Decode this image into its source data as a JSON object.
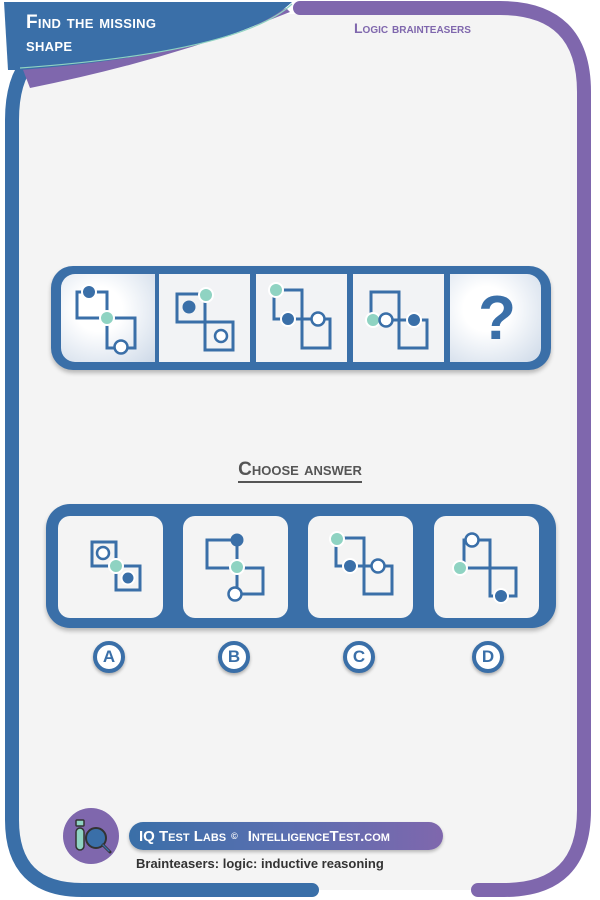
{
  "header": {
    "title_line1": "Find the missing",
    "title_line2": "shape",
    "category": "Logic brainteasers"
  },
  "colors": {
    "blue": "#3a6fa8",
    "purple": "#7f67ad",
    "teal": "#8fd3c2",
    "panel": "#f4f4f4"
  },
  "sequence": {
    "cells": [
      {
        "index": 1,
        "figure": "two-squares-diagonal-open-corners",
        "dots": [
          "navy top-left",
          "teal center",
          "white bottom"
        ]
      },
      {
        "index": 2,
        "figure": "two-squares-diagonal",
        "dots": [
          "navy inside top square",
          "teal top corner",
          "white inside bottom square"
        ]
      },
      {
        "index": 3,
        "figure": "two-squares-diagonal",
        "dots": [
          "teal top-left corner",
          "navy mid-left",
          "white mid-right"
        ]
      },
      {
        "index": 4,
        "figure": "two-squares-diagonal",
        "dots": [
          "teal left",
          "white middle",
          "navy right"
        ]
      },
      {
        "index": 5,
        "figure": "unknown",
        "placeholder": "?"
      }
    ]
  },
  "choose": {
    "heading": "Choose answer"
  },
  "answers": [
    {
      "label": "A",
      "dots": [
        "white inside top square",
        "teal center joint",
        "navy inside bottom square"
      ]
    },
    {
      "label": "B",
      "dots": [
        "navy top",
        "teal center",
        "white bottom"
      ]
    },
    {
      "label": "C",
      "dots": [
        "teal top-left",
        "navy middle-left",
        "white middle-right"
      ]
    },
    {
      "label": "D",
      "dots": [
        "white top",
        "teal left",
        "navy bottom-right"
      ]
    }
  ],
  "footer": {
    "brand": "IQ Test Labs",
    "copyright": "©",
    "site": "IntelligenceTest.com",
    "subtitle": "Brainteasers: logic: inductive reasoning",
    "logo_icon": "test-tube-magnifier-icon"
  }
}
